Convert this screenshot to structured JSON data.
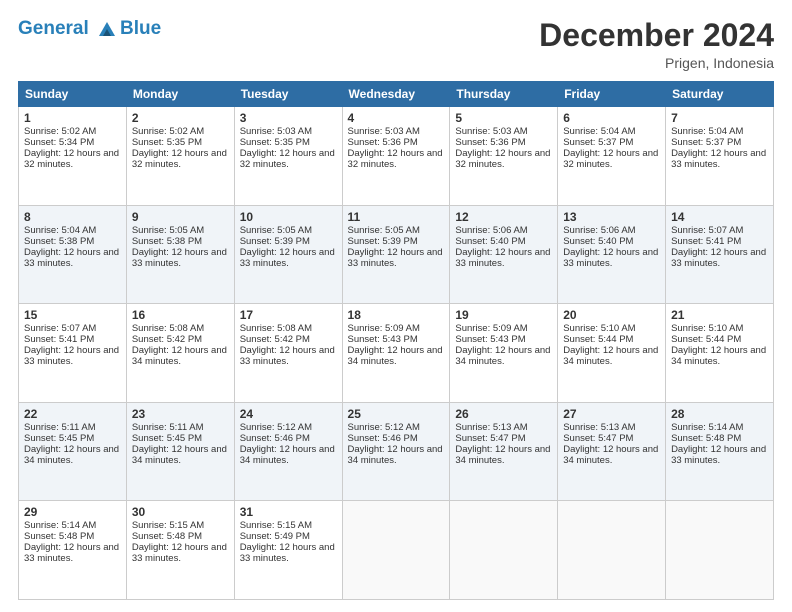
{
  "header": {
    "logo_line1": "General",
    "logo_line2": "Blue",
    "title": "December 2024",
    "subtitle": "Prigen, Indonesia"
  },
  "weekdays": [
    "Sunday",
    "Monday",
    "Tuesday",
    "Wednesday",
    "Thursday",
    "Friday",
    "Saturday"
  ],
  "weeks": [
    [
      {
        "day": "1",
        "sunrise": "5:02 AM",
        "sunset": "5:34 PM",
        "daylight": "12 hours and 32 minutes."
      },
      {
        "day": "2",
        "sunrise": "5:02 AM",
        "sunset": "5:35 PM",
        "daylight": "12 hours and 32 minutes."
      },
      {
        "day": "3",
        "sunrise": "5:03 AM",
        "sunset": "5:35 PM",
        "daylight": "12 hours and 32 minutes."
      },
      {
        "day": "4",
        "sunrise": "5:03 AM",
        "sunset": "5:36 PM",
        "daylight": "12 hours and 32 minutes."
      },
      {
        "day": "5",
        "sunrise": "5:03 AM",
        "sunset": "5:36 PM",
        "daylight": "12 hours and 32 minutes."
      },
      {
        "day": "6",
        "sunrise": "5:04 AM",
        "sunset": "5:37 PM",
        "daylight": "12 hours and 32 minutes."
      },
      {
        "day": "7",
        "sunrise": "5:04 AM",
        "sunset": "5:37 PM",
        "daylight": "12 hours and 33 minutes."
      }
    ],
    [
      {
        "day": "8",
        "sunrise": "5:04 AM",
        "sunset": "5:38 PM",
        "daylight": "12 hours and 33 minutes."
      },
      {
        "day": "9",
        "sunrise": "5:05 AM",
        "sunset": "5:38 PM",
        "daylight": "12 hours and 33 minutes."
      },
      {
        "day": "10",
        "sunrise": "5:05 AM",
        "sunset": "5:39 PM",
        "daylight": "12 hours and 33 minutes."
      },
      {
        "day": "11",
        "sunrise": "5:05 AM",
        "sunset": "5:39 PM",
        "daylight": "12 hours and 33 minutes."
      },
      {
        "day": "12",
        "sunrise": "5:06 AM",
        "sunset": "5:40 PM",
        "daylight": "12 hours and 33 minutes."
      },
      {
        "day": "13",
        "sunrise": "5:06 AM",
        "sunset": "5:40 PM",
        "daylight": "12 hours and 33 minutes."
      },
      {
        "day": "14",
        "sunrise": "5:07 AM",
        "sunset": "5:41 PM",
        "daylight": "12 hours and 33 minutes."
      }
    ],
    [
      {
        "day": "15",
        "sunrise": "5:07 AM",
        "sunset": "5:41 PM",
        "daylight": "12 hours and 33 minutes."
      },
      {
        "day": "16",
        "sunrise": "5:08 AM",
        "sunset": "5:42 PM",
        "daylight": "12 hours and 34 minutes."
      },
      {
        "day": "17",
        "sunrise": "5:08 AM",
        "sunset": "5:42 PM",
        "daylight": "12 hours and 33 minutes."
      },
      {
        "day": "18",
        "sunrise": "5:09 AM",
        "sunset": "5:43 PM",
        "daylight": "12 hours and 34 minutes."
      },
      {
        "day": "19",
        "sunrise": "5:09 AM",
        "sunset": "5:43 PM",
        "daylight": "12 hours and 34 minutes."
      },
      {
        "day": "20",
        "sunrise": "5:10 AM",
        "sunset": "5:44 PM",
        "daylight": "12 hours and 34 minutes."
      },
      {
        "day": "21",
        "sunrise": "5:10 AM",
        "sunset": "5:44 PM",
        "daylight": "12 hours and 34 minutes."
      }
    ],
    [
      {
        "day": "22",
        "sunrise": "5:11 AM",
        "sunset": "5:45 PM",
        "daylight": "12 hours and 34 minutes."
      },
      {
        "day": "23",
        "sunrise": "5:11 AM",
        "sunset": "5:45 PM",
        "daylight": "12 hours and 34 minutes."
      },
      {
        "day": "24",
        "sunrise": "5:12 AM",
        "sunset": "5:46 PM",
        "daylight": "12 hours and 34 minutes."
      },
      {
        "day": "25",
        "sunrise": "5:12 AM",
        "sunset": "5:46 PM",
        "daylight": "12 hours and 34 minutes."
      },
      {
        "day": "26",
        "sunrise": "5:13 AM",
        "sunset": "5:47 PM",
        "daylight": "12 hours and 34 minutes."
      },
      {
        "day": "27",
        "sunrise": "5:13 AM",
        "sunset": "5:47 PM",
        "daylight": "12 hours and 34 minutes."
      },
      {
        "day": "28",
        "sunrise": "5:14 AM",
        "sunset": "5:48 PM",
        "daylight": "12 hours and 33 minutes."
      }
    ],
    [
      {
        "day": "29",
        "sunrise": "5:14 AM",
        "sunset": "5:48 PM",
        "daylight": "12 hours and 33 minutes."
      },
      {
        "day": "30",
        "sunrise": "5:15 AM",
        "sunset": "5:48 PM",
        "daylight": "12 hours and 33 minutes."
      },
      {
        "day": "31",
        "sunrise": "5:15 AM",
        "sunset": "5:49 PM",
        "daylight": "12 hours and 33 minutes."
      },
      null,
      null,
      null,
      null
    ]
  ]
}
